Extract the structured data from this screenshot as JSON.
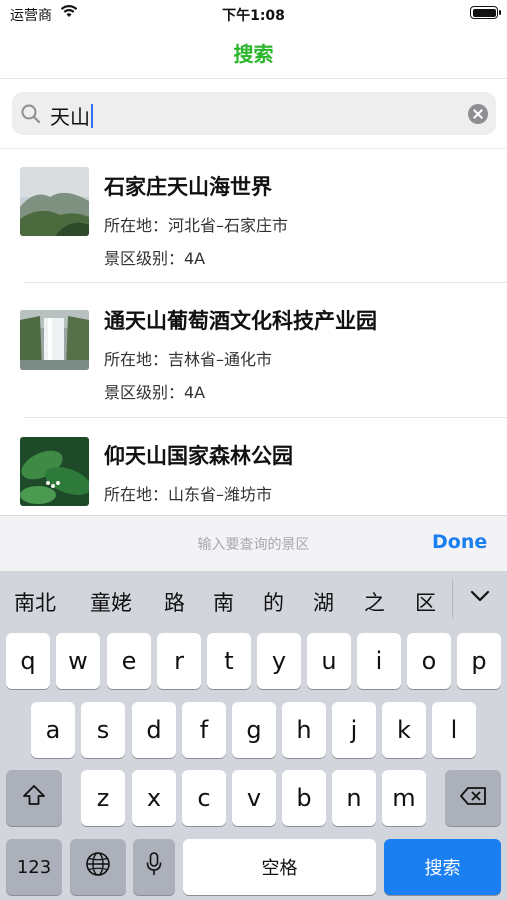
{
  "status_bar": {
    "carrier": "运营商",
    "time": "下午1:08"
  },
  "nav": {
    "title": "搜索"
  },
  "search": {
    "value": "天山"
  },
  "results": [
    {
      "title": "石家庄天山海世界",
      "location": "所在地：河北省–石家庄市",
      "level": "景区级别：4A"
    },
    {
      "title": "通天山葡萄酒文化科技产业园",
      "location": "所在地：吉林省–通化市",
      "level": "景区级别：4A"
    },
    {
      "title": "仰天山国家森林公园",
      "location": "所在地：山东省–潍坊市",
      "level": ""
    }
  ],
  "accessory": {
    "hint": "输入要查询的景区",
    "done": "Done"
  },
  "keyboard": {
    "candidates": [
      "南北",
      "童姥",
      "路",
      "南",
      "的",
      "湖",
      "之",
      "区"
    ],
    "row1": [
      "q",
      "w",
      "e",
      "r",
      "t",
      "y",
      "u",
      "i",
      "o",
      "p"
    ],
    "row2": [
      "a",
      "s",
      "d",
      "f",
      "g",
      "h",
      "j",
      "k",
      "l"
    ],
    "row3": [
      "z",
      "x",
      "c",
      "v",
      "b",
      "n",
      "m"
    ],
    "numbers_key": "123",
    "space_key": "空格",
    "return_key": "搜索"
  },
  "colors": {
    "title_green": "#2bb52b",
    "accent_blue": "#1a7ff0"
  },
  "icons": [
    "wifi-icon",
    "battery-icon",
    "search-icon",
    "clear-icon",
    "chevron-down-icon",
    "shift-icon",
    "delete-icon",
    "globe-icon",
    "mic-icon"
  ]
}
